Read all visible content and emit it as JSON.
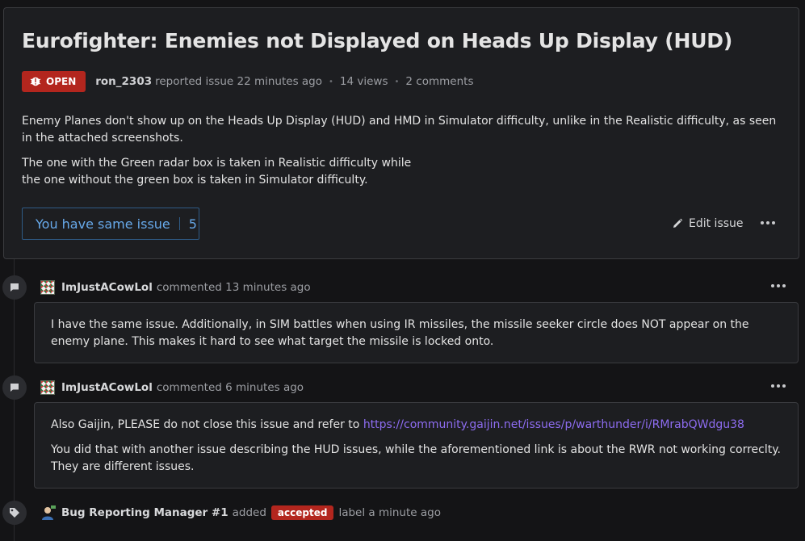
{
  "issue": {
    "title": "Eurofighter: Enemies not Displayed on Heads Up Display (HUD)",
    "status": "OPEN",
    "author": "ron_2303",
    "reported_text": "reported issue 22 minutes ago",
    "views": "14 views",
    "comments_count": "2 comments",
    "description": [
      "Enemy Planes don't show up on the Heads Up Display (HUD) and HMD in Simulator difficulty, unlike in the Realistic difficulty, as seen in the attached screenshots.",
      "The one with the Green radar box is taken in Realistic difficulty while",
      "the one without the green box is taken in Simulator difficulty."
    ],
    "same_issue_label": "You have same issue",
    "same_issue_count": "5",
    "edit_label": "Edit issue"
  },
  "comments": [
    {
      "user": "ImJustACowLol",
      "meta": "commented 13 minutes ago",
      "text": "I have the same issue. Additionally, in SIM battles when using IR missiles, the missile seeker circle does NOT appear on the enemy plane. This makes it hard to see what target the missile is locked onto."
    },
    {
      "user": "ImJustACowLol",
      "meta": "commented 6 minutes ago",
      "text_before_link": "Also Gaijin, PLEASE do not close this issue and refer to",
      "link": "https://community.gaijin.net/issues/p/warthunder/i/RMrabQWdgu38",
      "text2": "You did that with another issue describing the HUD issues, while the aforementioned link is about the RWR not working correclty. They are different issues."
    }
  ],
  "event": {
    "user": "Bug Reporting Manager #1",
    "action": "added",
    "label": "accepted",
    "suffix": "label a minute ago"
  },
  "colors": {
    "badge_red": "#b3261e",
    "link_purple": "#8d6cf0",
    "accent_blue": "#67a9ea"
  }
}
